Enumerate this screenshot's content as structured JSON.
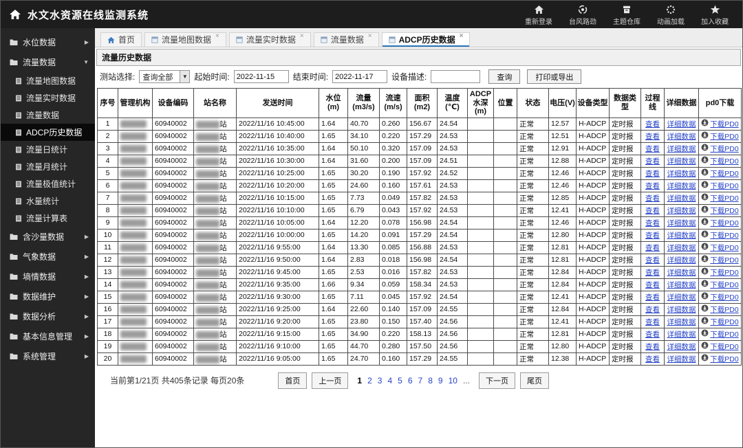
{
  "app_title": "水文水资源在线监测系统",
  "top_nav": [
    {
      "label": "重新登录",
      "icon": "relogin-icon"
    },
    {
      "label": "台风路劲",
      "icon": "typhoon-icon"
    },
    {
      "label": "主题仓库",
      "icon": "theme-icon"
    },
    {
      "label": "动画加载",
      "icon": "loading-icon"
    },
    {
      "label": "加入收藏",
      "icon": "favorite-star-icon"
    }
  ],
  "sidebar": [
    {
      "label": "水位数据",
      "expanded": false
    },
    {
      "label": "流量数据",
      "expanded": true,
      "children": [
        {
          "label": "流量地图数据",
          "active": false
        },
        {
          "label": "流量实时数据",
          "active": false
        },
        {
          "label": "流量数据",
          "active": false
        },
        {
          "label": "ADCP历史数据",
          "active": true
        },
        {
          "label": "流量日统计",
          "active": false
        },
        {
          "label": "流量月统计",
          "active": false
        },
        {
          "label": "流量极值统计",
          "active": false
        },
        {
          "label": "水量统计",
          "active": false
        },
        {
          "label": "流量计算表",
          "active": false
        }
      ]
    },
    {
      "label": "含沙量数据",
      "expanded": false
    },
    {
      "label": "气象数据",
      "expanded": false
    },
    {
      "label": "墒情数据",
      "expanded": false
    },
    {
      "label": "数据维护",
      "expanded": false
    },
    {
      "label": "数据分析",
      "expanded": false
    },
    {
      "label": "基本信息管理",
      "expanded": false
    },
    {
      "label": "系统管理",
      "expanded": false
    }
  ],
  "tabs": [
    {
      "label": "首页",
      "home": true,
      "closable": false,
      "active": false
    },
    {
      "label": "流量地图数据",
      "home": false,
      "closable": true,
      "active": false
    },
    {
      "label": "流量实时数据",
      "home": false,
      "closable": true,
      "active": false
    },
    {
      "label": "流量数据",
      "home": false,
      "closable": true,
      "active": false
    },
    {
      "label": "ADCP历史数据",
      "home": false,
      "closable": true,
      "active": true
    }
  ],
  "panel": {
    "title": "流量历史数据",
    "filters": {
      "station_label": "测站选择:",
      "station_value": "查询全部",
      "start_label": "起始时间:",
      "start_value": "2022-11-15",
      "end_label": "结束时间:",
      "end_value": "2022-11-17",
      "device_label": "设备描述:",
      "device_value": "",
      "search_button": "查询",
      "print_button": "打印或导出"
    }
  },
  "table": {
    "headers": [
      "序号",
      "管理机构",
      "设备编码",
      "站名称",
      "发送时间",
      "水位(m)",
      "流量(m3/s)",
      "流速(m/s)",
      "面积(m2)",
      "温度(℃)",
      "ADCP水深(m)",
      "位置",
      "状态",
      "电压(V)",
      "设备类型",
      "数据类型",
      "过程线",
      "详细数据",
      "pd0下载"
    ],
    "redacted_columns": [
      "管理机构",
      "站名称"
    ],
    "station_suffix": "站",
    "links": {
      "process": "查看",
      "detail": "详细数据",
      "pd0": "下载PD0"
    },
    "rows": [
      {
        "no": "1",
        "device": "60940002",
        "time": "2022/11/16 10:45:00",
        "level": "1.64",
        "flow": "40.70",
        "vel": "0.260",
        "area": "156.67",
        "temp": "24.54",
        "depth": "",
        "pos": "",
        "status": "正常",
        "volt": "12.57",
        "dev": "H-ADCP",
        "dtype": "定时报"
      },
      {
        "no": "2",
        "device": "60940002",
        "time": "2022/11/16 10:40:00",
        "level": "1.65",
        "flow": "34.10",
        "vel": "0.220",
        "area": "157.29",
        "temp": "24.53",
        "depth": "",
        "pos": "",
        "status": "正常",
        "volt": "12.51",
        "dev": "H-ADCP",
        "dtype": "定时报"
      },
      {
        "no": "3",
        "device": "60940002",
        "time": "2022/11/16 10:35:00",
        "level": "1.64",
        "flow": "50.10",
        "vel": "0.320",
        "area": "157.09",
        "temp": "24.53",
        "depth": "",
        "pos": "",
        "status": "正常",
        "volt": "12.91",
        "dev": "H-ADCP",
        "dtype": "定时报"
      },
      {
        "no": "4",
        "device": "60940002",
        "time": "2022/11/16 10:30:00",
        "level": "1.64",
        "flow": "31.60",
        "vel": "0.200",
        "area": "157.09",
        "temp": "24.51",
        "depth": "",
        "pos": "",
        "status": "正常",
        "volt": "12.88",
        "dev": "H-ADCP",
        "dtype": "定时报"
      },
      {
        "no": "5",
        "device": "60940002",
        "time": "2022/11/16 10:25:00",
        "level": "1.65",
        "flow": "30.20",
        "vel": "0.190",
        "area": "157.92",
        "temp": "24.52",
        "depth": "",
        "pos": "",
        "status": "正常",
        "volt": "12.46",
        "dev": "H-ADCP",
        "dtype": "定时报"
      },
      {
        "no": "6",
        "device": "60940002",
        "time": "2022/11/16 10:20:00",
        "level": "1.65",
        "flow": "24.60",
        "vel": "0.160",
        "area": "157.61",
        "temp": "24.53",
        "depth": "",
        "pos": "",
        "status": "正常",
        "volt": "12.46",
        "dev": "H-ADCP",
        "dtype": "定时报"
      },
      {
        "no": "7",
        "device": "60940002",
        "time": "2022/11/16 10:15:00",
        "level": "1.65",
        "flow": "7.73",
        "vel": "0.049",
        "area": "157.82",
        "temp": "24.53",
        "depth": "",
        "pos": "",
        "status": "正常",
        "volt": "12.85",
        "dev": "H-ADCP",
        "dtype": "定时报"
      },
      {
        "no": "8",
        "device": "60940002",
        "time": "2022/11/16 10:10:00",
        "level": "1.65",
        "flow": "6.79",
        "vel": "0.043",
        "area": "157.92",
        "temp": "24.53",
        "depth": "",
        "pos": "",
        "status": "正常",
        "volt": "12.41",
        "dev": "H-ADCP",
        "dtype": "定时报"
      },
      {
        "no": "9",
        "device": "60940002",
        "time": "2022/11/16 10:05:00",
        "level": "1.64",
        "flow": "12.20",
        "vel": "0.078",
        "area": "156.98",
        "temp": "24.54",
        "depth": "",
        "pos": "",
        "status": "正常",
        "volt": "12.46",
        "dev": "H-ADCP",
        "dtype": "定时报"
      },
      {
        "no": "10",
        "device": "60940002",
        "time": "2022/11/16 10:00:00",
        "level": "1.65",
        "flow": "14.20",
        "vel": "0.091",
        "area": "157.29",
        "temp": "24.54",
        "depth": "",
        "pos": "",
        "status": "正常",
        "volt": "12.80",
        "dev": "H-ADCP",
        "dtype": "定时报"
      },
      {
        "no": "11",
        "device": "60940002",
        "time": "2022/11/16 9:55:00",
        "level": "1.64",
        "flow": "13.30",
        "vel": "0.085",
        "area": "156.88",
        "temp": "24.53",
        "depth": "",
        "pos": "",
        "status": "正常",
        "volt": "12.81",
        "dev": "H-ADCP",
        "dtype": "定时报"
      },
      {
        "no": "12",
        "device": "60940002",
        "time": "2022/11/16 9:50:00",
        "level": "1.64",
        "flow": "2.83",
        "vel": "0.018",
        "area": "156.98",
        "temp": "24.54",
        "depth": "",
        "pos": "",
        "status": "正常",
        "volt": "12.81",
        "dev": "H-ADCP",
        "dtype": "定时报"
      },
      {
        "no": "13",
        "device": "60940002",
        "time": "2022/11/16 9:45:00",
        "level": "1.65",
        "flow": "2.53",
        "vel": "0.016",
        "area": "157.82",
        "temp": "24.53",
        "depth": "",
        "pos": "",
        "status": "正常",
        "volt": "12.84",
        "dev": "H-ADCP",
        "dtype": "定时报"
      },
      {
        "no": "14",
        "device": "60940002",
        "time": "2022/11/16 9:35:00",
        "level": "1.66",
        "flow": "9.34",
        "vel": "0.059",
        "area": "158.34",
        "temp": "24.53",
        "depth": "",
        "pos": "",
        "status": "正常",
        "volt": "12.84",
        "dev": "H-ADCP",
        "dtype": "定时报"
      },
      {
        "no": "15",
        "device": "60940002",
        "time": "2022/11/16 9:30:00",
        "level": "1.65",
        "flow": "7.11",
        "vel": "0.045",
        "area": "157.92",
        "temp": "24.54",
        "depth": "",
        "pos": "",
        "status": "正常",
        "volt": "12.41",
        "dev": "H-ADCP",
        "dtype": "定时报"
      },
      {
        "no": "16",
        "device": "60940002",
        "time": "2022/11/16 9:25:00",
        "level": "1.64",
        "flow": "22.60",
        "vel": "0.140",
        "area": "157.09",
        "temp": "24.55",
        "depth": "",
        "pos": "",
        "status": "正常",
        "volt": "12.84",
        "dev": "H-ADCP",
        "dtype": "定时报"
      },
      {
        "no": "17",
        "device": "60940002",
        "time": "2022/11/16 9:20:00",
        "level": "1.65",
        "flow": "23.80",
        "vel": "0.150",
        "area": "157.40",
        "temp": "24.56",
        "depth": "",
        "pos": "",
        "status": "正常",
        "volt": "12.41",
        "dev": "H-ADCP",
        "dtype": "定时报"
      },
      {
        "no": "18",
        "device": "60940002",
        "time": "2022/11/16 9:15:00",
        "level": "1.65",
        "flow": "34.90",
        "vel": "0.220",
        "area": "158.13",
        "temp": "24.56",
        "depth": "",
        "pos": "",
        "status": "正常",
        "volt": "12.81",
        "dev": "H-ADCP",
        "dtype": "定时报"
      },
      {
        "no": "19",
        "device": "60940002",
        "time": "2022/11/16 9:10:00",
        "level": "1.65",
        "flow": "44.70",
        "vel": "0.280",
        "area": "157.50",
        "temp": "24.56",
        "depth": "",
        "pos": "",
        "status": "正常",
        "volt": "12.80",
        "dev": "H-ADCP",
        "dtype": "定时报"
      },
      {
        "no": "20",
        "device": "60940002",
        "time": "2022/11/16 9:05:00",
        "level": "1.65",
        "flow": "24.70",
        "vel": "0.160",
        "area": "157.29",
        "temp": "24.55",
        "depth": "",
        "pos": "",
        "status": "正常",
        "volt": "12.38",
        "dev": "H-ADCP",
        "dtype": "定时报"
      }
    ]
  },
  "pagination": {
    "summary": "当前第1/21页 共405条记录 每页20条",
    "first": "首页",
    "prev": "上一页",
    "pages": [
      "1",
      "2",
      "3",
      "4",
      "5",
      "6",
      "7",
      "8",
      "9",
      "10",
      "..."
    ],
    "current": "1",
    "next": "下一页",
    "last": "尾页"
  }
}
